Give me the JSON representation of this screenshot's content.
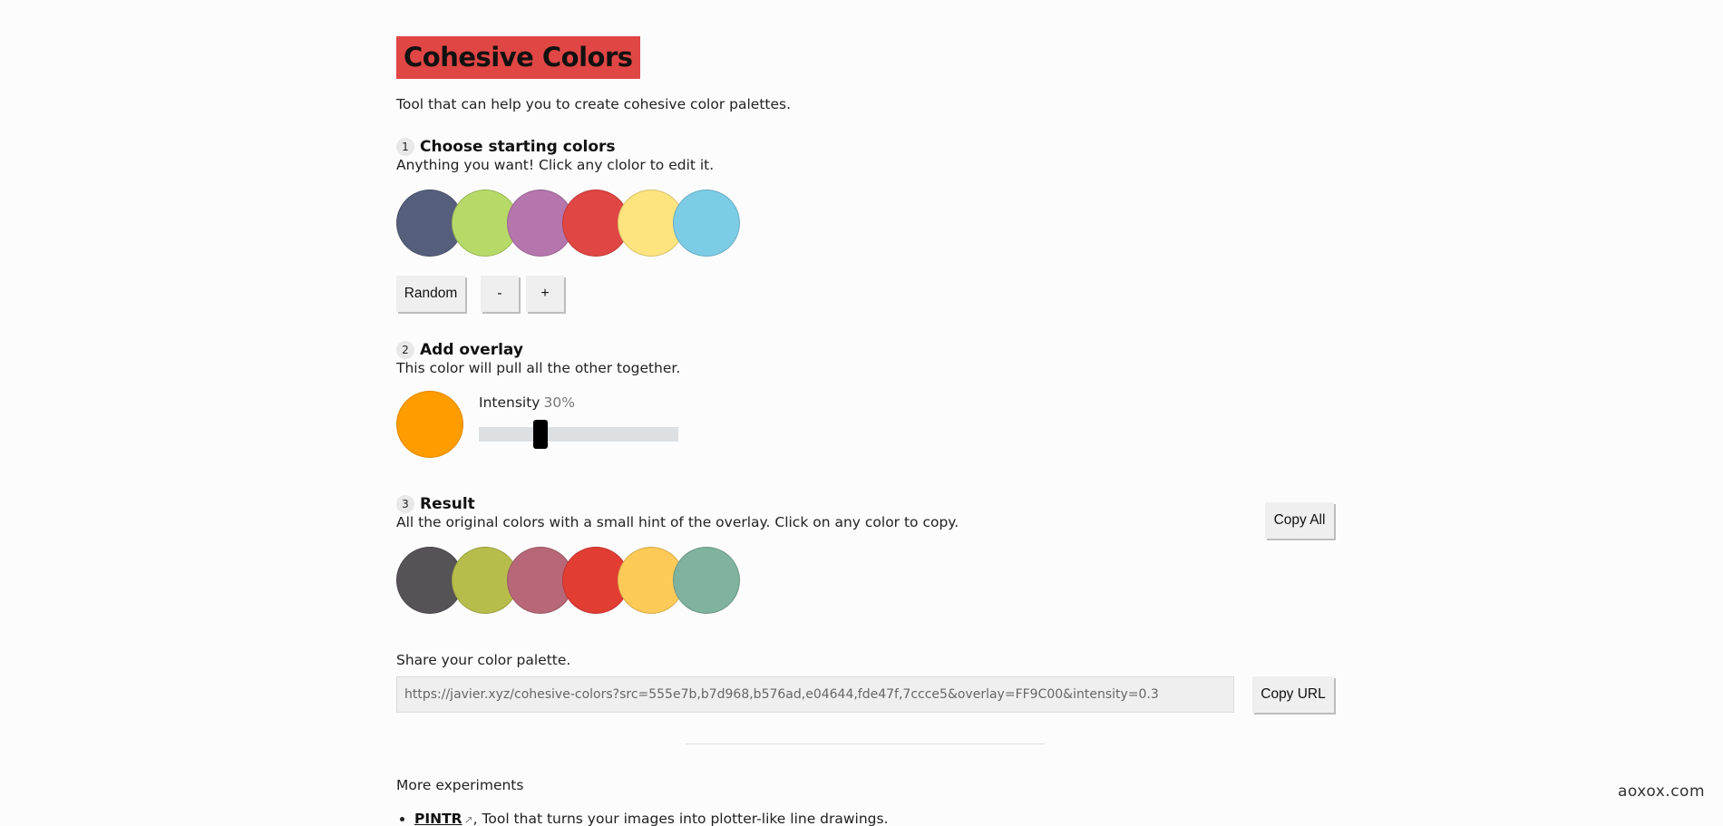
{
  "header": {
    "title": "Cohesive Colors",
    "subtitle": "Tool that can help you to create cohesive color palettes."
  },
  "step1": {
    "number": "1",
    "title": "Choose starting colors",
    "description": "Anything you want! Click any clolor to edit it.",
    "colors": [
      "#555e7b",
      "#b7d968",
      "#b576ad",
      "#e04644",
      "#fde47f",
      "#7ccce5"
    ],
    "random_label": "Random",
    "minus_label": "-",
    "plus_label": "+"
  },
  "step2": {
    "number": "2",
    "title": "Add overlay",
    "description": "This color will pull all the other together.",
    "overlay_color": "#FF9C00",
    "intensity_label": "Intensity",
    "intensity_value": "30%",
    "intensity_fraction": 0.3
  },
  "step3": {
    "number": "3",
    "title": "Result",
    "description": "All the original colors with a small hint of the overlay. Click on any color to copy.",
    "copy_all_label": "Copy All",
    "colors": [
      "#565357",
      "#b7bd4b",
      "#b76778",
      "#e13d33",
      "#fdca58",
      "#7fb29f"
    ]
  },
  "share": {
    "label": "Share your color palette.",
    "url": "https://javier.xyz/cohesive-colors?src=555e7b,b7d968,b576ad,e04644,fde47f,7ccce5&overlay=FF9C00&intensity=0.3",
    "copy_url_label": "Copy URL"
  },
  "more": {
    "label": "More experiments",
    "items": [
      {
        "link": "PINTR",
        "text": ", Tool that turns your images into plotter-like line drawings."
      }
    ]
  },
  "watermark": "aoxox.com",
  "icons": {
    "external_link": "external-link-icon"
  }
}
